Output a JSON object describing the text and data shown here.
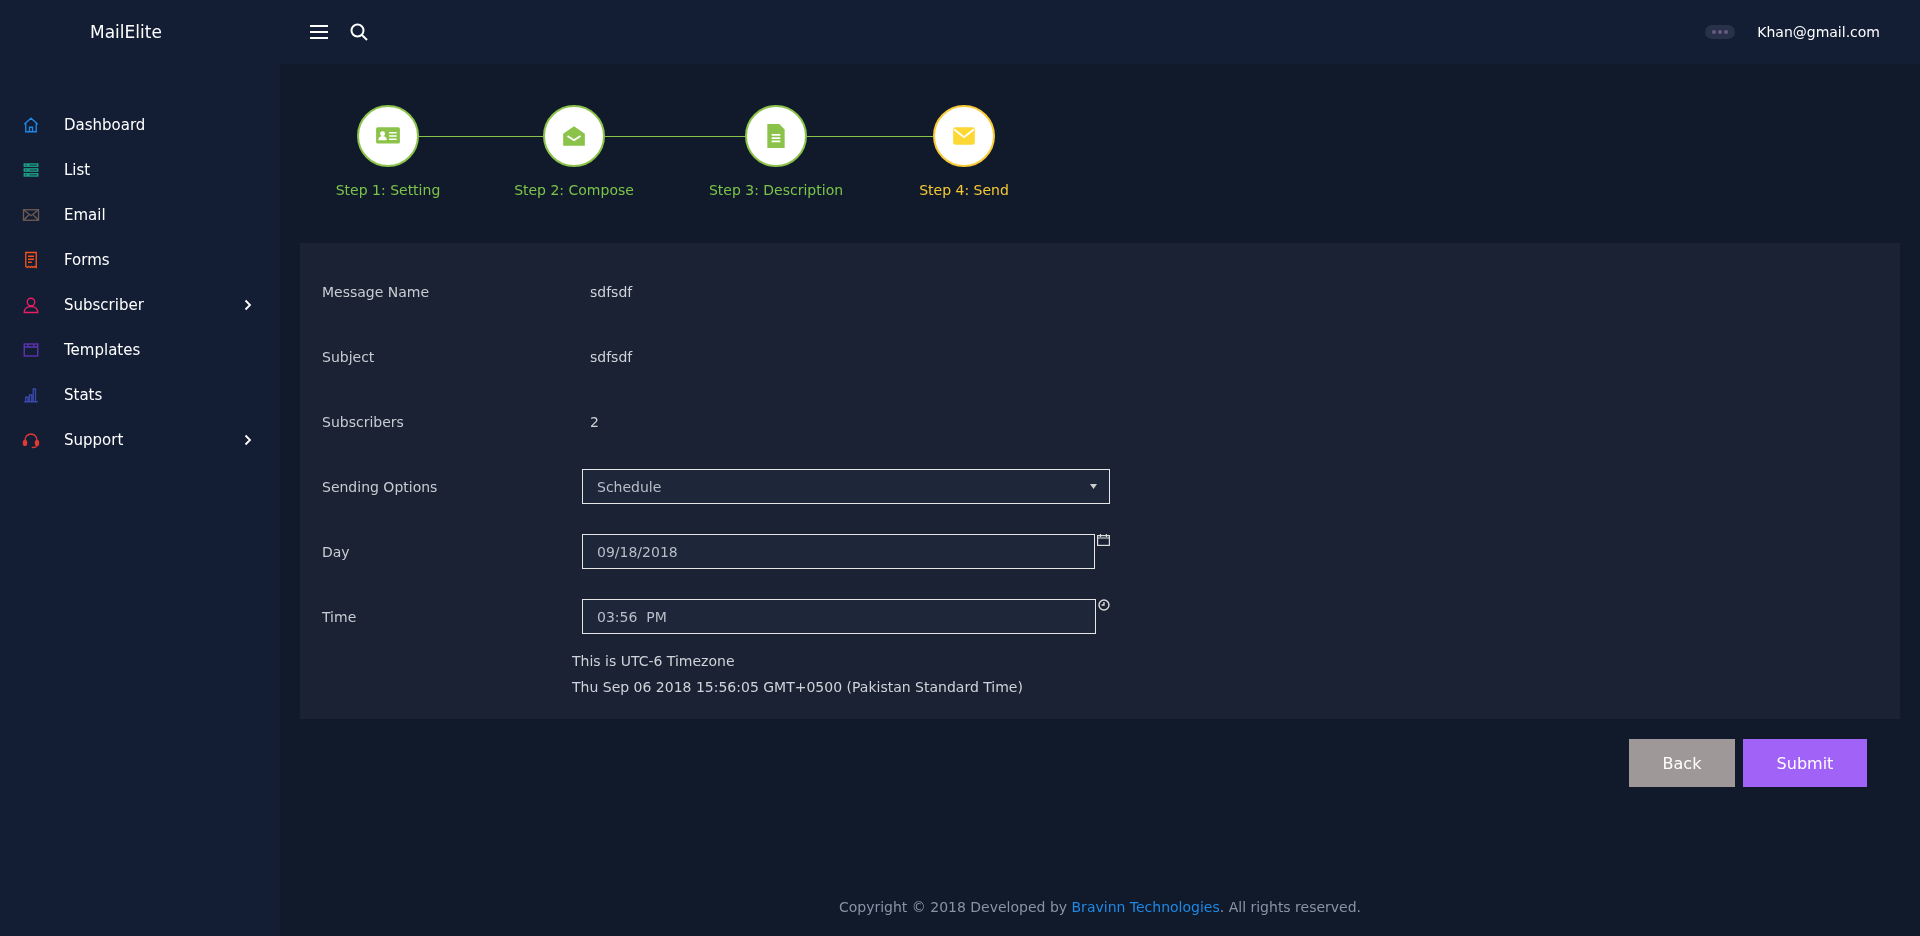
{
  "brand": "MailElite",
  "user": {
    "email": "Khan@gmail.com"
  },
  "sidebar": {
    "items": [
      {
        "label": "Dashboard",
        "color": "#1e88e5",
        "has_submenu": false
      },
      {
        "label": "List",
        "color": "#1fa58a",
        "has_submenu": false
      },
      {
        "label": "Email",
        "color": "#6d5a55",
        "has_submenu": false
      },
      {
        "label": "Forms",
        "color": "#f4511e",
        "has_submenu": false
      },
      {
        "label": "Subscriber",
        "color": "#e91e63",
        "has_submenu": true
      },
      {
        "label": "Templates",
        "color": "#5e35b1",
        "has_submenu": false
      },
      {
        "label": "Stats",
        "color": "#3949ab",
        "has_submenu": false
      },
      {
        "label": "Support",
        "color": "#e53935",
        "has_submenu": true
      }
    ]
  },
  "steps": [
    {
      "label": "Step 1: Setting",
      "selected": false
    },
    {
      "label": "Step 2: Compose",
      "selected": false
    },
    {
      "label": "Step 3: Description",
      "selected": false
    },
    {
      "label": "Step 4: Send",
      "selected": true
    }
  ],
  "form": {
    "rows": [
      {
        "kind": "text",
        "label": "Message Name",
        "value": "sdfsdf"
      },
      {
        "kind": "text",
        "label": "Subject",
        "value": "sdfsdf"
      },
      {
        "kind": "text",
        "label": "Subscribers",
        "value": "2"
      },
      {
        "kind": "select",
        "label": "Sending Options",
        "value": "Schedule"
      },
      {
        "kind": "date",
        "label": "Day",
        "value": "09/18/2018"
      },
      {
        "kind": "time",
        "label": "Time",
        "value": "03:56  PM"
      }
    ],
    "notes": [
      "This is UTC-6 Timezone",
      "Thu Sep 06 2018 15:56:05 GMT+0500 (Pakistan Standard Time)"
    ]
  },
  "buttons": [
    {
      "label": "Back",
      "kind": "secondary"
    },
    {
      "label": "Submit",
      "kind": "primary"
    }
  ],
  "footer": {
    "before": "Copyright © 2018 Developed by ",
    "link": "Bravinn Technologies",
    "after": ". All rights reserved."
  }
}
